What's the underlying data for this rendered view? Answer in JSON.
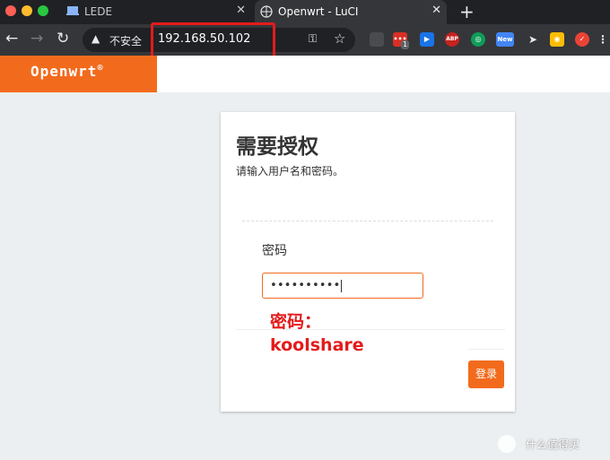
{
  "tabs": [
    {
      "title": "LEDE"
    },
    {
      "title": "Openwrt - LuCI"
    }
  ],
  "toolbar": {
    "insecure_label": "不安全",
    "url": "192.168.50.102"
  },
  "extensions": [
    {
      "name": "ext-badge-1",
      "badge": "1"
    },
    {
      "name": "abp",
      "label": "ABP"
    },
    {
      "name": "new",
      "label": "New"
    }
  ],
  "header": {
    "logo": "Openwrt"
  },
  "login": {
    "title": "需要授权",
    "description": "请输入用户名和密码。",
    "password_label": "密码",
    "password_mask": "••••••••••",
    "submit_label": "登录"
  },
  "annotation": {
    "line1": "密码：",
    "line2": "koolshare"
  },
  "watermark": {
    "text": "什么值得买"
  },
  "colors": {
    "accent": "#f26b1d",
    "annotation": "#e41b1b"
  }
}
